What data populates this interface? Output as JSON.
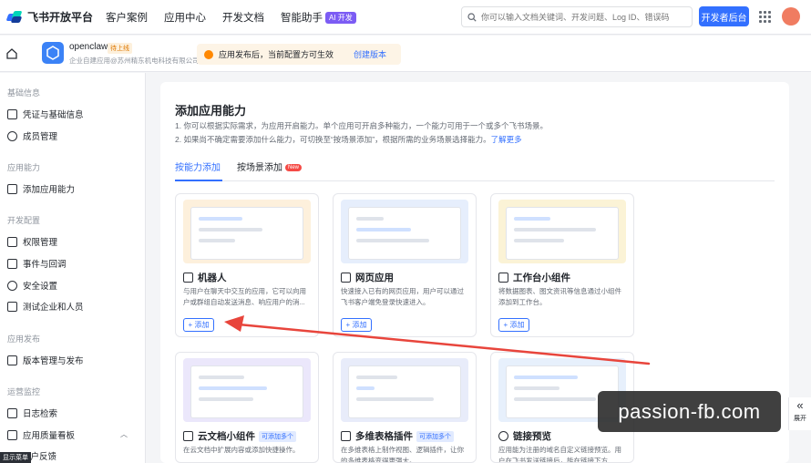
{
  "topbar": {
    "brand": "飞书开放平台",
    "nav": [
      "客户案例",
      "应用中心",
      "开发文档",
      "智能助手"
    ],
    "ai_badge": "AI 开发",
    "search_placeholder": "你可以输入文档关键词、开发问题、Log ID、错误码",
    "dev_console": "开发者后台"
  },
  "app": {
    "name": "openclaw",
    "status": "待上线",
    "desc": "企业自建应用@苏州精东机电科技有限公司",
    "notice": "应用发布后，当前配置方可生效",
    "notice_link": "创建版本"
  },
  "sidebar": {
    "sections": [
      {
        "title": "基础信息",
        "items": [
          "凭证与基础信息",
          "成员管理"
        ]
      },
      {
        "title": "应用能力",
        "items": [
          "添加应用能力"
        ]
      },
      {
        "title": "开发配置",
        "items": [
          "权限管理",
          "事件与回调",
          "安全设置",
          "测试企业和人员"
        ]
      },
      {
        "title": "应用发布",
        "items": [
          "版本管理与发布"
        ]
      },
      {
        "title": "运营监控",
        "items": [
          "日志检索",
          "应用质量看板",
          "用户反馈"
        ]
      }
    ],
    "tip": "显示菜单"
  },
  "main": {
    "title": "添加应用能力",
    "intro1": "1. 你可以根据实际需求，为应用开启能力。单个应用可开启多种能力，一个能力可用于一个或多个飞书场景。",
    "intro2": "2. 如果尚不确定需要添加什么能力，可切换至“按场景添加”，根据所需的业务场景选择能力。",
    "learn_more": "了解更多",
    "tabs": [
      "按能力添加",
      "按场景添加"
    ],
    "new_badge": "New",
    "add_label": "+ 添加",
    "cards": [
      {
        "title": "机器人",
        "desc": "与用户在聊天中交互的应用，它可以向用户或群组自动发送消息、响应用户的消..."
      },
      {
        "title": "网页应用",
        "desc": "快速接入已有的网页应用，用户可以通过飞书客户端免登录快速进入。"
      },
      {
        "title": "工作台小组件",
        "desc": "将数据图表、图文资讯等信息通过小组件添加到工作台。"
      },
      {
        "title": "云文档小组件",
        "badge": "可添加多个",
        "desc": "在云文档中扩展内容或添加快捷操作。"
      },
      {
        "title": "多维表格插件",
        "badge": "可添加多个",
        "desc": "在多维表格上制作视图、逻辑插件，让你的多维表格变得更强大。"
      },
      {
        "title": "链接预览",
        "desc": "应用能为注册的域名自定义链接预览。用户在飞书发送链接后，能在链接下方..."
      }
    ]
  },
  "overlay": {
    "watermark": "passion-fb.com",
    "expand": "展开"
  },
  "colors": {
    "primary": "#3370ff",
    "arrow": "#e8453c",
    "watermark_bg": "#262626"
  }
}
